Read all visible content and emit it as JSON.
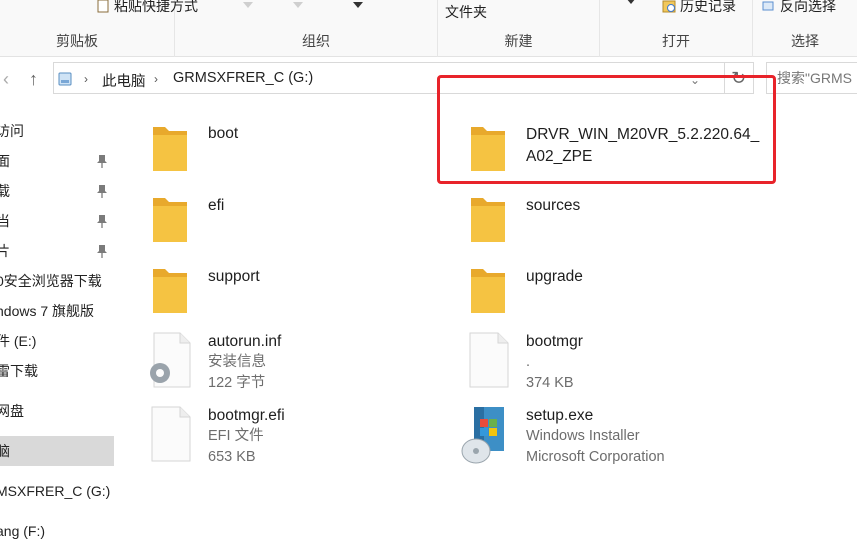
{
  "ribbon": {
    "clipboard": {
      "label": "剪贴板",
      "top_item": "粘贴快捷方式"
    },
    "organize": {
      "label": "组织"
    },
    "new": {
      "label": "新建",
      "top_item": "文件夹"
    },
    "open": {
      "label": "打开",
      "top_item": "历史记录"
    },
    "select": {
      "label": "选择",
      "top_item": "反向选择"
    }
  },
  "address_bar": {
    "breadcrumb": [
      "此电脑",
      "GRMSXFRER_C (G:)"
    ],
    "search_placeholder": "搜索\"GRMS"
  },
  "nav_pane": {
    "items": [
      {
        "label": "访问",
        "pinned": false
      },
      {
        "label": "面",
        "pinned": true
      },
      {
        "label": "载",
        "pinned": true
      },
      {
        "label": "当",
        "pinned": true
      },
      {
        "label": "片",
        "pinned": true
      },
      {
        "label": "0安全浏览器下载",
        "pinned": false
      },
      {
        "label": "ndows 7 旗舰版",
        "pinned": false
      },
      {
        "label": "件 (E:)",
        "pinned": false
      },
      {
        "label": "雷下载",
        "pinned": false
      },
      {
        "label": "网盘",
        "pinned": false
      },
      {
        "label": "脑",
        "pinned": false,
        "selected": true
      },
      {
        "label": "MSXFRER_C (G:)",
        "pinned": false
      },
      {
        "label": "ang (F:)",
        "pinned": false
      }
    ]
  },
  "files": [
    {
      "name": "boot",
      "type": "folder",
      "sub1": "",
      "sub2": ""
    },
    {
      "name": "DRVR_WIN_M20VR_5.2.220.64_",
      "name2": "A02_ZPE",
      "type": "folder",
      "highlighted": true
    },
    {
      "name": "efi",
      "type": "folder"
    },
    {
      "name": "sources",
      "type": "folder"
    },
    {
      "name": "support",
      "type": "folder"
    },
    {
      "name": "upgrade",
      "type": "folder"
    },
    {
      "name": "autorun.inf",
      "type": "inf",
      "sub1": "安装信息",
      "sub2": "122 字节"
    },
    {
      "name": "bootmgr",
      "type": "file",
      "sub1": ".",
      "sub2": "374 KB"
    },
    {
      "name": "bootmgr.efi",
      "type": "file",
      "sub1": "EFI 文件",
      "sub2": "653 KB"
    },
    {
      "name": "setup.exe",
      "type": "exe",
      "sub1": "Windows Installer",
      "sub2": "Microsoft Corporation"
    }
  ],
  "colors": {
    "folder": "#f5c342",
    "folder_back": "#e8a92c",
    "highlight": "#e8232a",
    "selected_nav": "#d9d9d9"
  }
}
